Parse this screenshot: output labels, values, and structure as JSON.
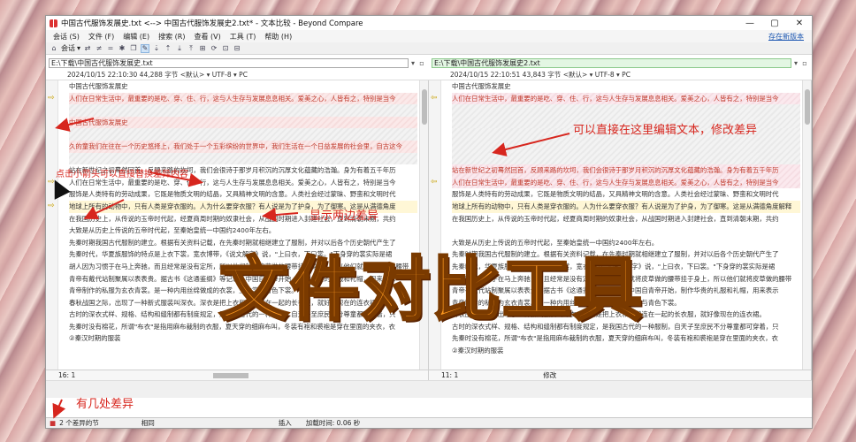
{
  "window": {
    "title": "中国古代服饰发展史.txt <--> 中国古代服饰发展史2.txt* - 文本比较 - Beyond Compare",
    "controls": [
      "—",
      "▢",
      "✕"
    ]
  },
  "menu": {
    "items": [
      "会话 (S)",
      "文件 (F)",
      "编辑 (E)",
      "搜索 (R)",
      "查看 (V)",
      "工具 (T)",
      "帮助 (H)"
    ],
    "new_version": "存在新版本"
  },
  "toolbar": {
    "session_label": "会话"
  },
  "left": {
    "path": "E:\\下载\\中国古代服饰发展史.txt",
    "info": "2024/10/15 22:10:30    44,288 字节    <默认> ▾   UTF-8 ▾   PC",
    "lines": [
      {
        "t": "中国古代服饰发展史",
        "k": "n"
      },
      {
        "t": "人们在日常生活中，最重要的是吃、穿、住、行，这与人生存与发展息息相关。爱美之心，人皆有之，特别是当今",
        "k": "d"
      },
      {
        "t": "",
        "k": "e"
      },
      {
        "t": "中国古代服饰发展史",
        "k": "d"
      },
      {
        "t": "",
        "k": "e"
      },
      {
        "t": "久的童我们在往在一个历史悠择上，我们处于一个五彩缤纷的世界中，我们生活在一个日益发展的社会里，自古这今",
        "k": "d"
      },
      {
        "t": "",
        "k": "e"
      },
      {
        "t": "站在新世纪之初蓦然回首，反顾来路的坎坷，我们会很诗于那岁月积沉的沉厚文化蕴藏的浩瀚。身为有着五千年历",
        "k": "n"
      },
      {
        "t": "人们在日常生活中，最重要的是吃、穿、住、行，这与人生存与发展息息相关。爱美之心，人皆有之，特别是当今",
        "k": "n"
      },
      {
        "t": "服饰是人类特有的劳动成果，它既是物质文明的结晶，又具精神文明的含意。人类社会经过蒙昧、野蛮和文明时代",
        "k": "n"
      },
      {
        "t": "地球上所有的动物中，只有人类是穿衣服的。人为什么要穿衣服？有人说是为了护身，为了御寒。这是从满德角度",
        "k": "h"
      },
      {
        "t": "在我国历史上，从传说的玉帝时代起，经夏商周时期的奴隶社会，从战国时期进入封建社会，直到清朝末期，共约",
        "k": "n"
      },
      {
        "t": "大致是从历史上传说的五帝时代起，至秦始皇统一中国约2400年左右。",
        "k": "n"
      },
      {
        "t": "先秦时期我国古代服制的建立。根据有关资料记载，在先秦时期就相继建立了服制，并对以后各个历史朝代产生了",
        "k": "n"
      },
      {
        "t": "先秦时代，华夏族服饰的特点是上衣下裳，宽衣博带，《说文解字》说，\"上曰衣，下曰裳。\"下身穿的裳实际是裙",
        "k": "n"
      },
      {
        "t": "胡人因为习惯于在马上奔驰，而且经常是没有定所，所以他们就将皮草做的腰带挂于身上，所以他们就将皮草做的腰带",
        "k": "n"
      },
      {
        "t": "青帝有戴代站制聚属以表表贵。据古书《这通鉴纲》等记载，中国自青帝开始，制作华贵的礼服和礼帽，用来表示",
        "k": "n"
      },
      {
        "t": "青帝制作的私服为玄衣青裳。是一种内用丝绵做成的衣裳，上衣裳与青色下裳。",
        "k": "n"
      },
      {
        "t": "春秋战国之际，出现了一种新式服装叫深衣。深衣是把上衣和下裳连在一起的长衣服，就好像现在的连衣裙。",
        "k": "n"
      },
      {
        "t": "古时的深衣式样、规格、结构和缝制都有制度规定，是我国古代的一种服制，自天子至庶民不分尊童都可穿着，只",
        "k": "n"
      },
      {
        "t": "先秦时没有棉花，所谓\"布衣\"是指用麻布裁制的衣服，夏天穿的细麻布叫，冬装有袍和裘袍是穿在里面的夹衣，衣",
        "k": "n"
      },
      {
        "t": "②秦汉时期的服装",
        "k": "n"
      },
      {
        "t": "",
        "k": "n"
      },
      {
        "t": "",
        "k": "n"
      }
    ],
    "status_pos": "16: 1"
  },
  "right": {
    "path": "E:\\下载\\中国古代服饰发展史2.txt",
    "info": "2024/10/15 22:10:51    43,843 字节    <默认> ▾   UTF-8 ▾   PC",
    "lines": [
      {
        "t": "中国古代服饰发展史",
        "k": "n"
      },
      {
        "t": "人们在日常生活中，最重要的是吃、穿、住、行，这与人生存与发展息息相关。爱美之心，人皆有之，特别是当今",
        "k": "d"
      },
      {
        "t": "",
        "k": "e"
      },
      {
        "t": "",
        "k": "e"
      },
      {
        "t": "",
        "k": "e"
      },
      {
        "t": "",
        "k": "e"
      },
      {
        "t": "",
        "k": "e"
      },
      {
        "t": "站在新世纪之初蓦然回首，反顾来路的坎坷，我们会很诗于那岁月积沉的沉厚文化蕴藏的浩瀚。身为有着五千年历",
        "k": "d"
      },
      {
        "t": "人们在日常生活中，最重要的是吃、穿、住、行，这与人生存与发展息息相关。爱美之心，人皆有之，特别是当今",
        "k": "d"
      },
      {
        "t": "服饰是人类特有的劳动成果，它既是物质文明的结晶，又具精神文明的含意。人类社会经过蒙昧、野蛮和文明时代",
        "k": "n"
      },
      {
        "t": "地球上所有的动物中，只有人类是穿衣服的。人为什么要穿衣服？有人说是为了护身，为了御寒。这是从满德角度解释",
        "k": "h"
      },
      {
        "t": "在我国历史上，从传说的玉帝时代起，经夏商周时期的奴隶社会，从战国时期进入封建社会，直到清朝末期，共约",
        "k": "n"
      },
      {
        "t": "",
        "k": "n"
      },
      {
        "t": "大致是从历史上传说的五帝时代起，至秦始皇统一中国约2400年左右。",
        "k": "n"
      },
      {
        "t": "先秦时期我国古代服制的建立。根据有关资料记载，在先秦时期就相继建立了服制，并对以后各个历史朝代产生了",
        "k": "n"
      },
      {
        "t": "先秦时代，华夏族服饰的特点是上衣下裳，宽衣博带，《说文解字》说，\"上曰衣，下曰裳。\"下身穿的裳实际是裙",
        "k": "n"
      },
      {
        "t": "胡人因为习惯于在马上奔驰，而且经常是没有定所，所以他们就将皮草做的腰带挂于身上，所以他们就将皮草做的腰带",
        "k": "n"
      },
      {
        "t": "青帝有戴代站制聚属以表表贵。据古书《这通鉴纲》等记载，中国自青帝开始，制作华贵的礼服和礼帽，用来表示",
        "k": "n"
      },
      {
        "t": "青帝制作的私服为玄衣青裳。是一种内用丝绵做成的衣裳，上衣裳与青色下裳。",
        "k": "n"
      },
      {
        "t": "春秋战国之际，出现了一种新式服装叫深衣。深衣是把上衣和下裳连在一起的长衣服，就好像现在的连衣裙。",
        "k": "n"
      },
      {
        "t": "古时的深衣式样、规格、结构和缝制都有制度规定，是我国古代的一种服制，自天子至庶民不分尊童都可穿着，只",
        "k": "n"
      },
      {
        "t": "先秦时没有棉花，所谓\"布衣\"是指用麻布裁制的衣服，夏天穿的细麻布叫，冬装有袍和裘袍是穿在里面的夹衣，衣",
        "k": "n"
      },
      {
        "t": "②秦汉时期的服装",
        "k": "n"
      },
      {
        "t": "",
        "k": "n"
      }
    ],
    "status_pos": "11: 1",
    "status_mode": "修改"
  },
  "statusbar": {
    "diff_count": "2 个差异的节",
    "same": "相同",
    "insert": "插入",
    "load_time": "加载时间: 0.06 秒"
  },
  "annotations": {
    "left_tip": "点击小箭头可以直接替换差异内容",
    "edit_tip": "可以直接在这里编辑文本，修改差异",
    "show_diff": "显示两边差异",
    "big_title": "文件对比工具",
    "diff_count_tip": "有几处差异"
  }
}
